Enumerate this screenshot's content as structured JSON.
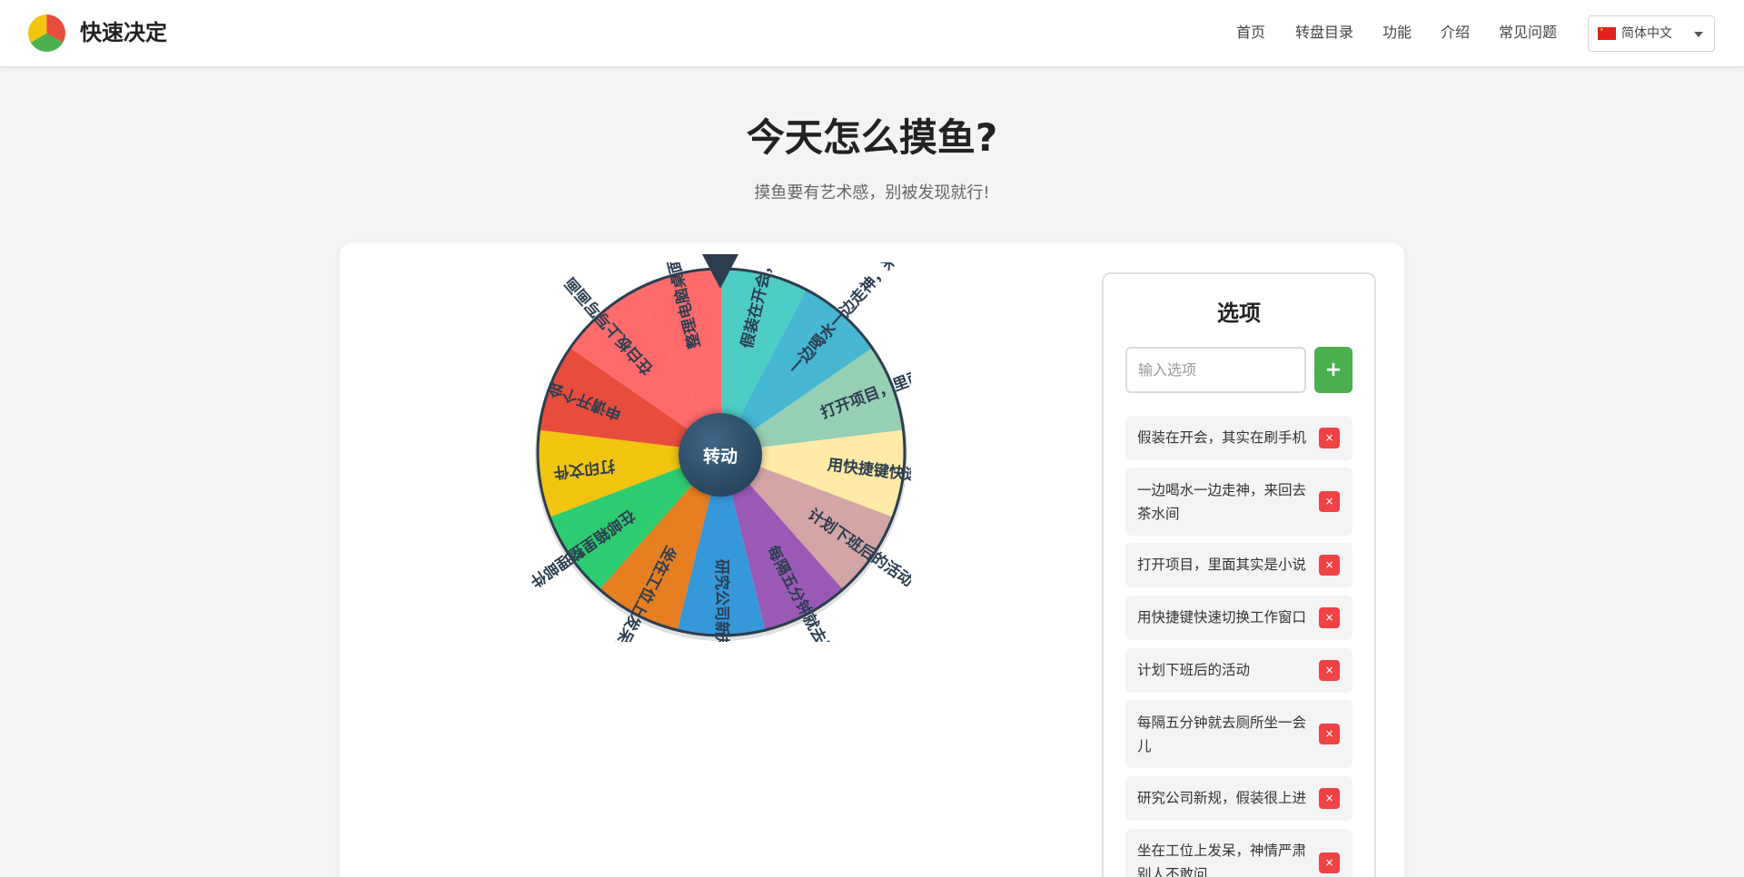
{
  "app": {
    "brand": "快速决定"
  },
  "nav": {
    "items": [
      "首页",
      "转盘目录",
      "功能",
      "介绍",
      "常见问题"
    ]
  },
  "lang": {
    "label": "简体中文",
    "flag_color": "#de2910"
  },
  "hero": {
    "title": "今天怎么摸鱼?",
    "subtitle": "摸鱼要有艺术感，别被发现就行!"
  },
  "wheel": {
    "spin_label": "转动",
    "segments": [
      {
        "label": "假装在开会，其实在刷手机",
        "color": "#4ecdc4"
      },
      {
        "label": "一边喝水一边走神，来回去茶水间",
        "color": "#45b7d1"
      },
      {
        "label": "打开项目，里面其实是小说",
        "color": "#96cfb4"
      },
      {
        "label": "用快捷键快速切换工作窗口",
        "color": "#ffeaa7"
      },
      {
        "label": "计划下班后的活动",
        "color": "#d4a5a5"
      },
      {
        "label": "每隔五分钟就去厕所坐一会儿",
        "color": "#9b59b6"
      },
      {
        "label": "研究公司新规，假装很上进",
        "color": "#3498db"
      },
      {
        "label": "坐在工位上发呆，神情严肃别人不敢问",
        "color": "#e67e22"
      },
      {
        "label": "在邮箱里整理邮件",
        "color": "#2ecc71"
      },
      {
        "label": "打印文件",
        "color": "#f1c40f"
      },
      {
        "label": "申请开个会",
        "color": "#e74c3c"
      },
      {
        "label": "在白板上写写画画",
        "color": "#ff6b6b"
      },
      {
        "label": "整理电脑桌面",
        "color": "#ff6b6b"
      }
    ]
  },
  "options": {
    "title": "选项",
    "input_placeholder": "输入选项",
    "add_label": "+",
    "delete_label": "×",
    "items": [
      "假装在开会，其实在刷手机",
      "一边喝水一边走神，来回去茶水间",
      "打开项目，里面其实是小说",
      "用快捷键快速切换工作窗口",
      "计划下班后的活动",
      "每隔五分钟就去厕所坐一会儿",
      "研究公司新规，假装很上进",
      "坐在工位上发呆，神情严肃别人不敢问"
    ]
  }
}
